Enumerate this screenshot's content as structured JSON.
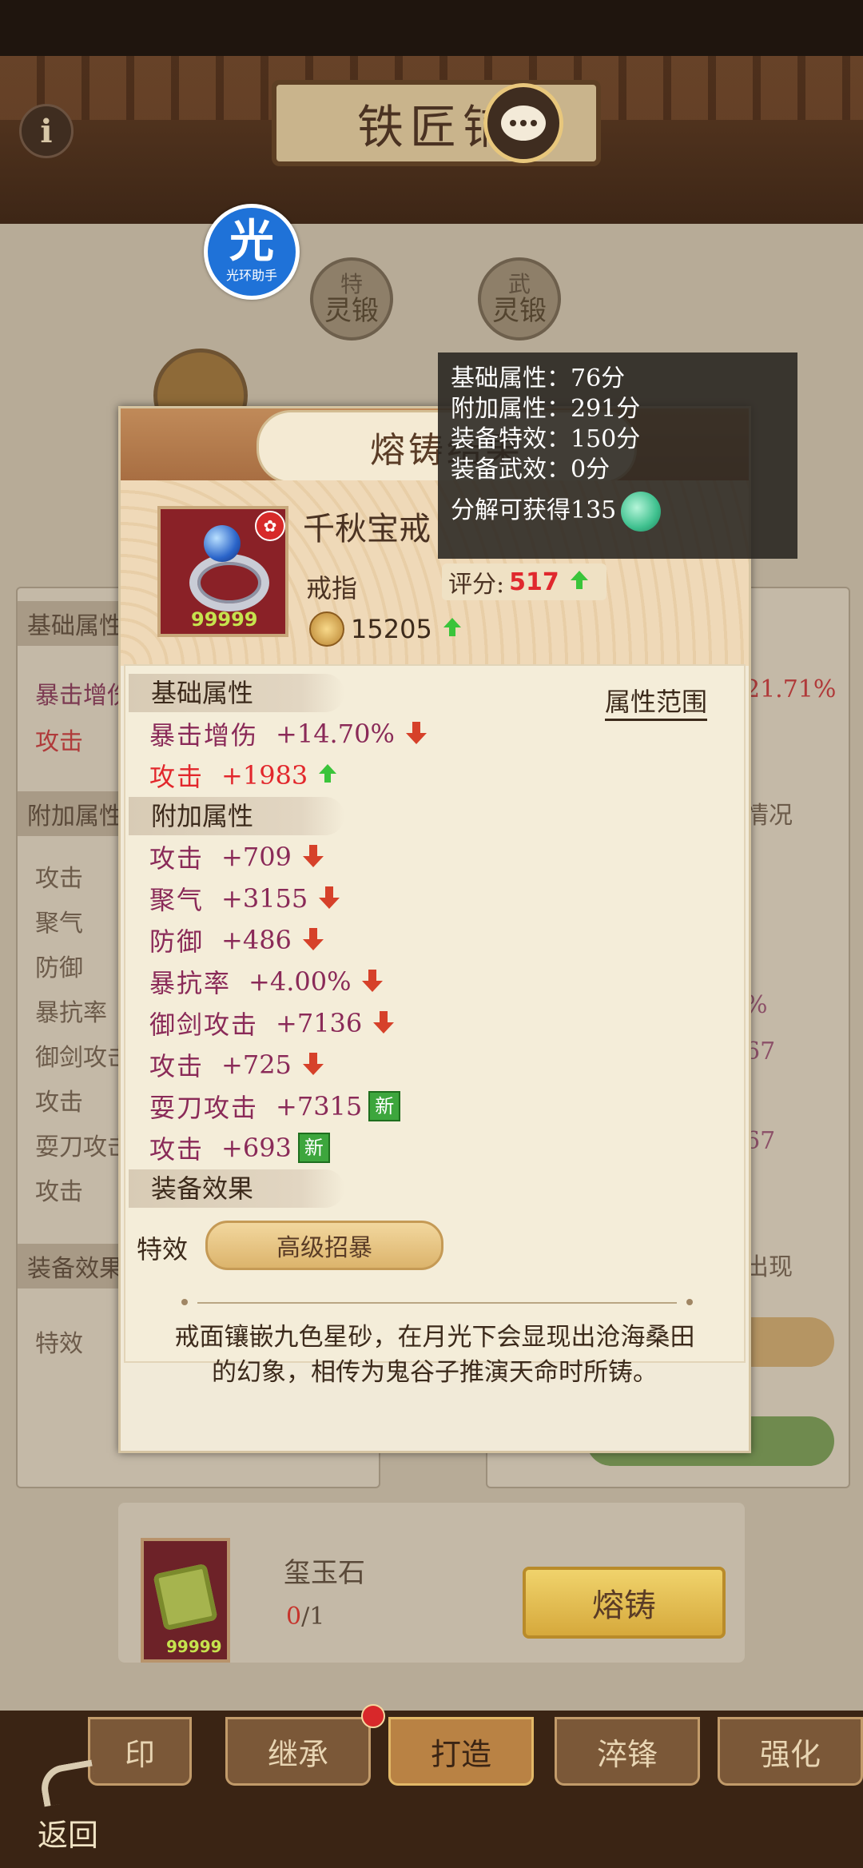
{
  "header": {
    "title": "铁匠铺"
  },
  "overlay_app": {
    "glyph": "光",
    "label": "光环助手"
  },
  "skills": [
    {
      "line1": "特",
      "line2": "灵锻"
    },
    {
      "line1": "武",
      "line2": "灵锻"
    }
  ],
  "background_panel": {
    "left_sections": [
      "基础属性",
      "附加属性",
      "装备效果"
    ],
    "left_rows": [
      "暴击增伤",
      "攻击",
      "攻击",
      "聚气",
      "防御",
      "暴抗率",
      "御剑攻击",
      "攻击",
      "耍刀攻击",
      "攻击",
      "特效"
    ],
    "right_fragments": [
      "21.71%",
      "情况",
      "%",
      "67",
      "67",
      "出现"
    ]
  },
  "tooltip": {
    "rows": [
      "基础属性：76分",
      "附加属性：291分",
      "装备特效：150分",
      "装备武效：0分"
    ],
    "decompose": "分解可获得135",
    "currency_icon": "jade-coin-icon"
  },
  "modal": {
    "title": "熔铸结果",
    "item": {
      "name": "千秋宝戒",
      "type": "戒指",
      "badge": "✿",
      "count": "99999",
      "score_label": "评分:",
      "score_value": "517",
      "power": "15205"
    },
    "range_link": "属性范围",
    "sections": {
      "base": "基础属性",
      "extra": "附加属性",
      "effects": "装备效果"
    },
    "base_stats": [
      {
        "name": "暴击增伤",
        "value": "+14.70%",
        "trend": "down"
      },
      {
        "name": "攻击",
        "value": "+1983",
        "trend": "up"
      }
    ],
    "extra_stats": [
      {
        "name": "攻击",
        "value": "+709",
        "trend": "down"
      },
      {
        "name": "聚气",
        "value": "+3155",
        "trend": "down"
      },
      {
        "name": "防御",
        "value": "+486",
        "trend": "down"
      },
      {
        "name": "暴抗率",
        "value": "+4.00%",
        "trend": "down"
      },
      {
        "name": "御剑攻击",
        "value": "+7136",
        "trend": "down"
      },
      {
        "name": "攻击",
        "value": "+725",
        "trend": "down"
      },
      {
        "name": "耍刀攻击",
        "value": "+7315",
        "tag": "新"
      },
      {
        "name": "攻击",
        "value": "+693",
        "tag": "新"
      }
    ],
    "effect_label": "特效",
    "effect_value": "高级招暴",
    "description": "戒面镶嵌九色星砂，在月光下会显现出沧海桑田的幻象，相传为鬼谷子推演天命时所铸。"
  },
  "material": {
    "name": "玺玉石",
    "have": "0",
    "need": "/1",
    "count": "99999",
    "forge_button": "熔铸"
  },
  "tabs": [
    "印",
    "继承",
    "打造",
    "淬锋",
    "强化"
  ],
  "active_tab": "打造",
  "back_label": "返回"
}
